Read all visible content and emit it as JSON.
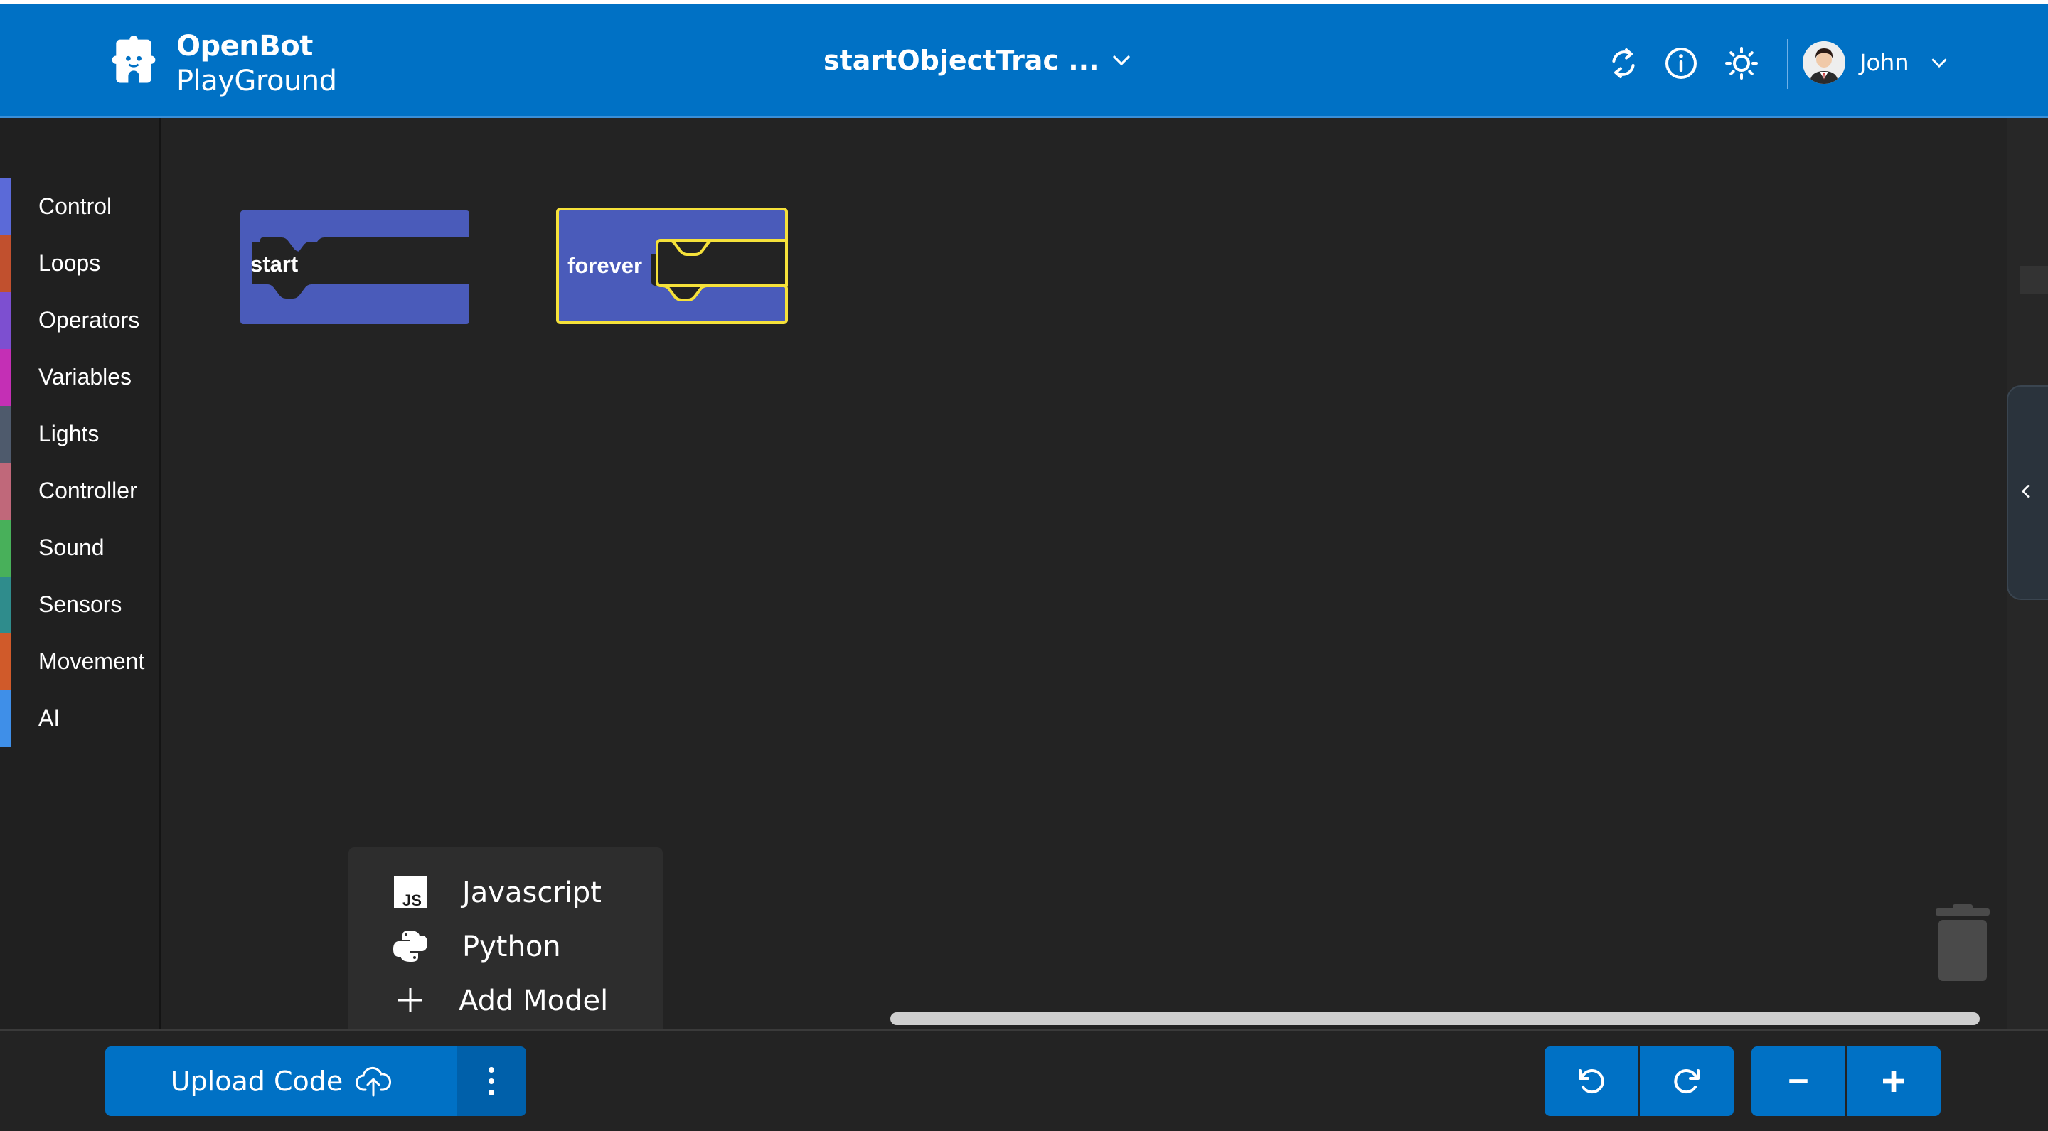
{
  "app": {
    "name_line1": "OpenBot",
    "name_line2": "PlayGround"
  },
  "header": {
    "project_title": "startObjectTrac ...",
    "user_name": "John",
    "icons": [
      "sync-icon",
      "info-icon",
      "theme-sun-icon"
    ]
  },
  "sidebar": {
    "categories": [
      {
        "label": "Control",
        "color": "#5b6ad8"
      },
      {
        "label": "Loops",
        "color": "#c1502e"
      },
      {
        "label": "Operators",
        "color": "#7d4fd0"
      },
      {
        "label": "Variables",
        "color": "#c42fb5"
      },
      {
        "label": "Lights",
        "color": "#4e5a6c"
      },
      {
        "label": "Controller",
        "color": "#c0687a"
      },
      {
        "label": "Sound",
        "color": "#48b05a"
      },
      {
        "label": "Sensors",
        "color": "#2f8c8c"
      },
      {
        "label": "Movement",
        "color": "#d05a2a"
      },
      {
        "label": "AI",
        "color": "#3f8fe8"
      }
    ]
  },
  "workspace": {
    "blocks": [
      {
        "label": "start",
        "selected": false
      },
      {
        "label": "forever",
        "selected": true
      }
    ]
  },
  "menu": {
    "items": [
      {
        "label": "Javascript",
        "icon": "javascript-icon"
      },
      {
        "label": "Python",
        "icon": "python-icon"
      },
      {
        "label": "Add Model",
        "icon": "plus-icon"
      }
    ]
  },
  "bottom": {
    "upload_label": "Upload Code"
  },
  "colors": {
    "primary": "#0071c5",
    "block": "#4a5bba",
    "block_highlight": "#f5e13a",
    "background": "#232323"
  }
}
